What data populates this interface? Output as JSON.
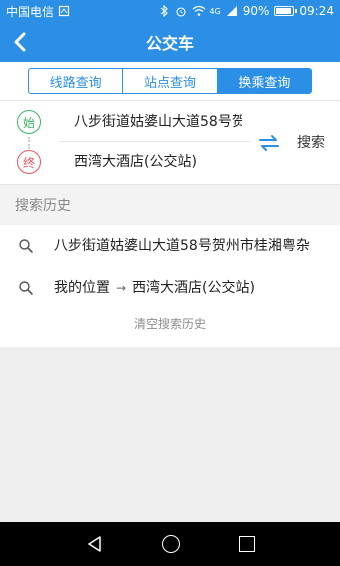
{
  "status_bar": {
    "carrier": "中国电信",
    "network": "4G",
    "battery": "90%",
    "time": "09:24",
    "battery_level": 0.9
  },
  "header": {
    "title": "公交车"
  },
  "tabs": [
    {
      "label": "线路查询",
      "active": false
    },
    {
      "label": "站点查询",
      "active": false
    },
    {
      "label": "换乘查询",
      "active": true
    }
  ],
  "route": {
    "start_badge": "始",
    "end_badge": "终",
    "start_value": "八步街道姑婆山大道58号贺",
    "end_value": "西湾大酒店(公交站)",
    "search_label": "搜索"
  },
  "history": {
    "title": "搜索历史",
    "items": [
      {
        "text": "八步街道姑婆山大道58号贺州市桂湘粤杂"
      },
      {
        "from": "我的位置",
        "to": "西湾大酒店(公交站)"
      }
    ],
    "clear_label": "清空搜索历史"
  },
  "icons": {
    "back": "chevron-left-icon",
    "swap": "swap-arrows-icon",
    "search": "magnifier-icon",
    "nav_back": "triangle-back-icon",
    "nav_home": "circle-home-icon",
    "nav_recent": "square-recent-icon"
  },
  "colors": {
    "primary": "#2b8fe6",
    "start_green": "#3bb55f",
    "end_red": "#e8545e"
  }
}
